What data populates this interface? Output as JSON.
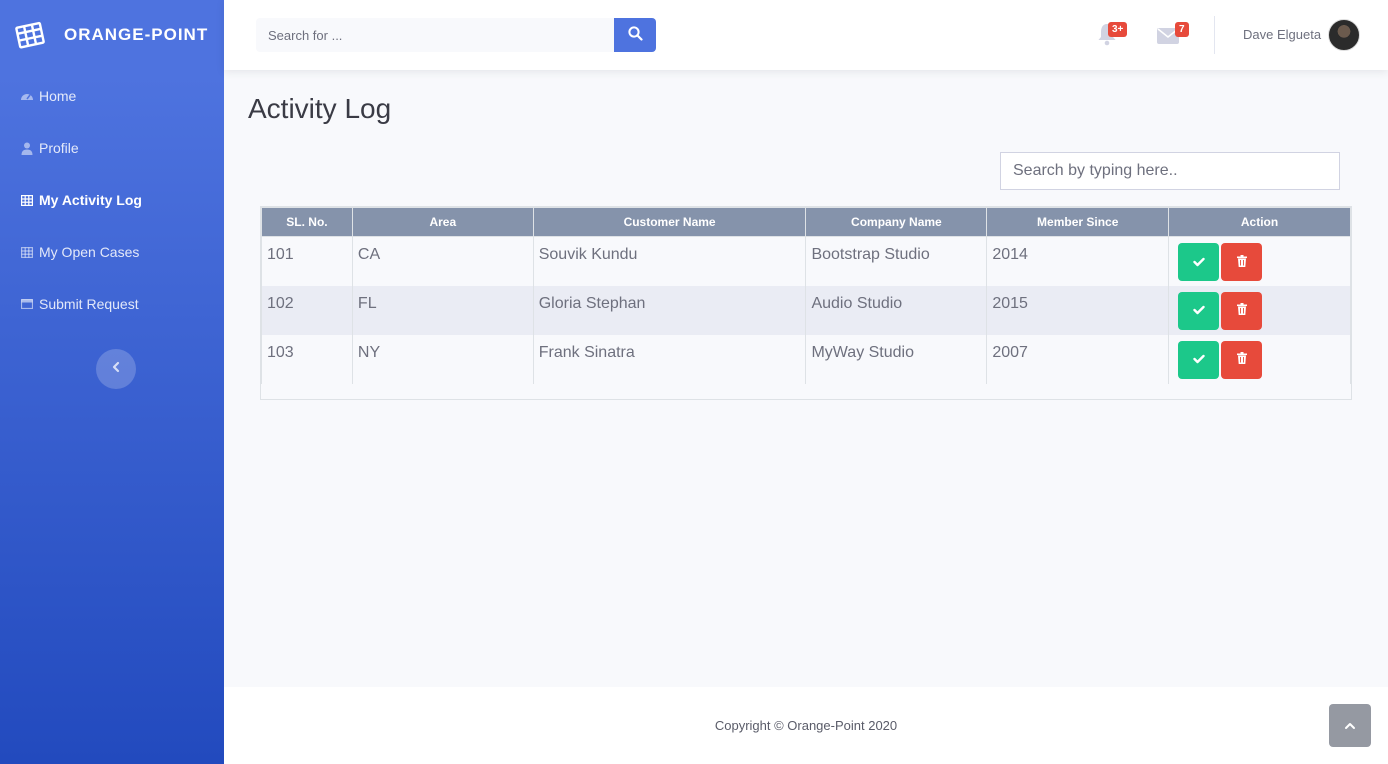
{
  "brand": {
    "name": "ORANGE-POINT",
    "icon": "table-icon"
  },
  "sidebar": {
    "items": [
      {
        "label": "Home",
        "icon": "dashboard-icon",
        "active": false
      },
      {
        "label": "Profile",
        "icon": "user-icon",
        "active": false
      },
      {
        "label": "My Activity Log",
        "icon": "table-icon",
        "active": true
      },
      {
        "label": "My Open Cases",
        "icon": "table-icon",
        "active": false
      },
      {
        "label": "Submit Request",
        "icon": "window-icon",
        "active": false
      }
    ],
    "toggle_icon": "chevron-left-icon"
  },
  "topbar": {
    "search_placeholder": "Search for ...",
    "alerts_badge": "3+",
    "messages_badge": "7",
    "user_name": "Dave Elgueta"
  },
  "main": {
    "title": "Activity Log",
    "table_search_placeholder": "Search by typing here..",
    "table": {
      "headers": [
        "SL. No.",
        "Area",
        "Customer Name",
        "Company Name",
        "Member Since",
        "Action"
      ],
      "rows": [
        {
          "sl": "101",
          "area": "CA",
          "customer": "Souvik Kundu",
          "company": "Bootstrap Studio",
          "since": "2014"
        },
        {
          "sl": "102",
          "area": "FL",
          "customer": "Gloria Stephan",
          "company": "Audio Studio",
          "since": "2015"
        },
        {
          "sl": "103",
          "area": "NY",
          "customer": "Frank Sinatra",
          "company": "MyWay Studio",
          "since": "2007"
        }
      ]
    }
  },
  "footer": {
    "copyright": "Copyright © Orange-Point 2020"
  },
  "colors": {
    "primary": "#4e73df",
    "success": "#1cc88a",
    "danger": "#e74a3b",
    "header": "#8593ab"
  }
}
